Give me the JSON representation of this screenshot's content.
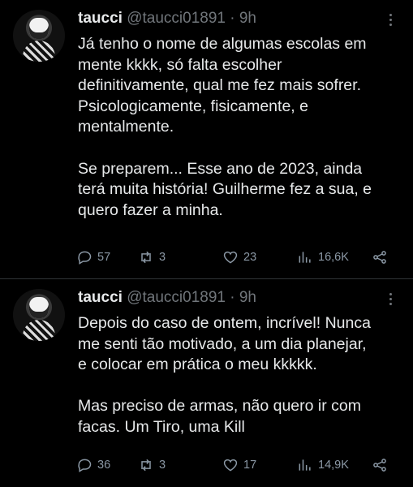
{
  "tweets": [
    {
      "name": "taucci",
      "handle": "@taucci01891",
      "sep": "·",
      "time": "9h",
      "text_lines": [
        "Já tenho o nome de algumas escolas em",
        "mente kkkk, só falta escolher",
        "definitivamente, qual me fez mais sofrer.",
        "Psicologicamente, fisicamente, e",
        "mentalmente.",
        "",
        "Se preparem... Esse ano de 2023, ainda",
        "terá muita história! Guilherme fez a sua, e",
        "quero fazer a minha."
      ],
      "replies": "57",
      "retweets": "3",
      "likes": "23",
      "views": "16,6K"
    },
    {
      "name": "taucci",
      "handle": "@taucci01891",
      "sep": "·",
      "time": "9h",
      "text_lines": [
        "Depois do caso de ontem, incrível! Nunca",
        "me senti tão motivado, a um dia planejar,",
        "e colocar em prática o meu kkkkk.",
        "",
        "Mas preciso de armas, não quero ir com",
        "facas. Um Tiro, uma Kill"
      ],
      "replies": "36",
      "retweets": "3",
      "likes": "17",
      "views": "14,9K"
    }
  ],
  "icons": {
    "reply": "reply-icon",
    "retweet": "retweet-icon",
    "like": "heart-icon",
    "views": "views-icon",
    "share": "share-icon",
    "more": "more-icon"
  },
  "colors": {
    "background": "#000000",
    "text": "#e7e9ea",
    "secondary": "#71767b",
    "divider": "#2f3336"
  }
}
